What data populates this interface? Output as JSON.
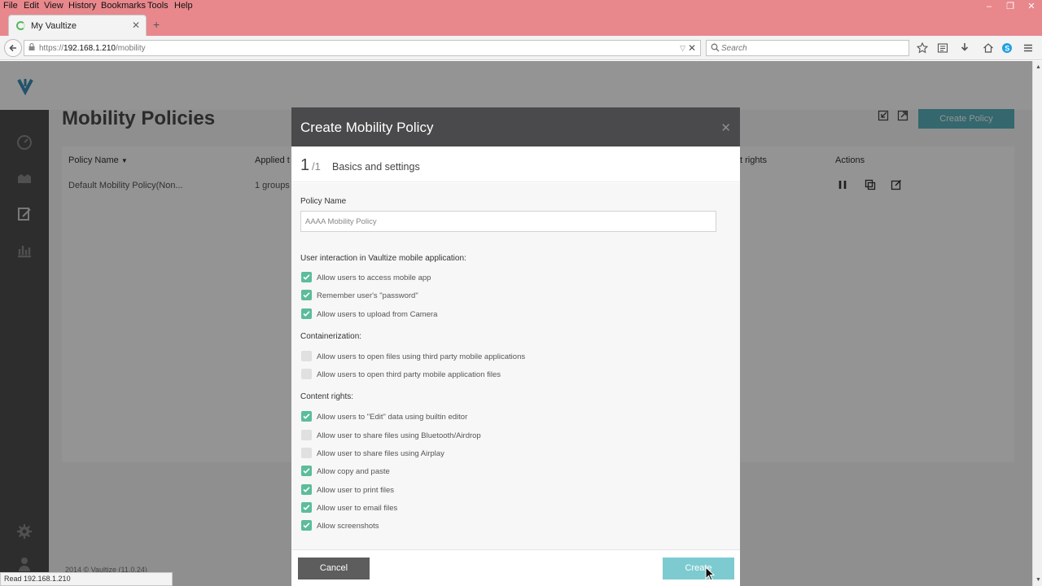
{
  "browser": {
    "menu": [
      "File",
      "Edit",
      "View",
      "History",
      "Bookmarks",
      "Tools",
      "Help"
    ],
    "tab_title": "My Vaultize",
    "url_prefix": "https://",
    "url_host": "192.168.1.210",
    "url_path": "/mobility",
    "search_placeholder": "Search",
    "status_text": "Read 192.168.1.210"
  },
  "page": {
    "title": "Mobility Policies",
    "create_policy_label": "Create Policy",
    "columns": [
      "Policy Name",
      "Applied t",
      "t rights",
      "Actions"
    ],
    "row": {
      "policy_name": "Default Mobility Policy(Non...",
      "applied_to": "1 groups"
    },
    "footer": "2014 © Vaultize (11.0.24)"
  },
  "modal": {
    "title": "Create Mobility Policy",
    "step_number": "1",
    "step_total": "/1",
    "step_name": "Basics and settings",
    "policy_name_label": "Policy Name",
    "policy_name_value": "AAAA Mobility Policy",
    "sections": [
      {
        "heading": "User interaction in Vaultize mobile application:",
        "options": [
          {
            "label": "Allow users to access mobile app",
            "checked": true
          },
          {
            "label": "Remember user's \"password\"",
            "checked": true
          },
          {
            "label": "Allow users to upload from Camera",
            "checked": true
          }
        ]
      },
      {
        "heading": "Containerization:",
        "options": [
          {
            "label": "Allow users to open files using third party mobile applications",
            "checked": false
          },
          {
            "label": "Allow users to open third party mobile application files",
            "checked": false
          }
        ]
      },
      {
        "heading": "Content rights:",
        "options": [
          {
            "label": "Allow users to \"Edit\" data using builtin editor",
            "checked": true
          },
          {
            "label": "Allow user to share files using Bluetooth/Airdrop",
            "checked": false
          },
          {
            "label": "Allow user to share files using Airplay",
            "checked": false
          },
          {
            "label": "Allow copy and paste",
            "checked": true
          },
          {
            "label": "Allow user to print files",
            "checked": true
          },
          {
            "label": "Allow user to email files",
            "checked": true
          },
          {
            "label": "Allow screenshots",
            "checked": true
          }
        ]
      }
    ],
    "cancel_label": "Cancel",
    "create_label": "Create"
  },
  "colors": {
    "accent": "#5ab2be",
    "checkbox_on": "#5bbd9a",
    "browser_chrome": "#e8888c"
  }
}
